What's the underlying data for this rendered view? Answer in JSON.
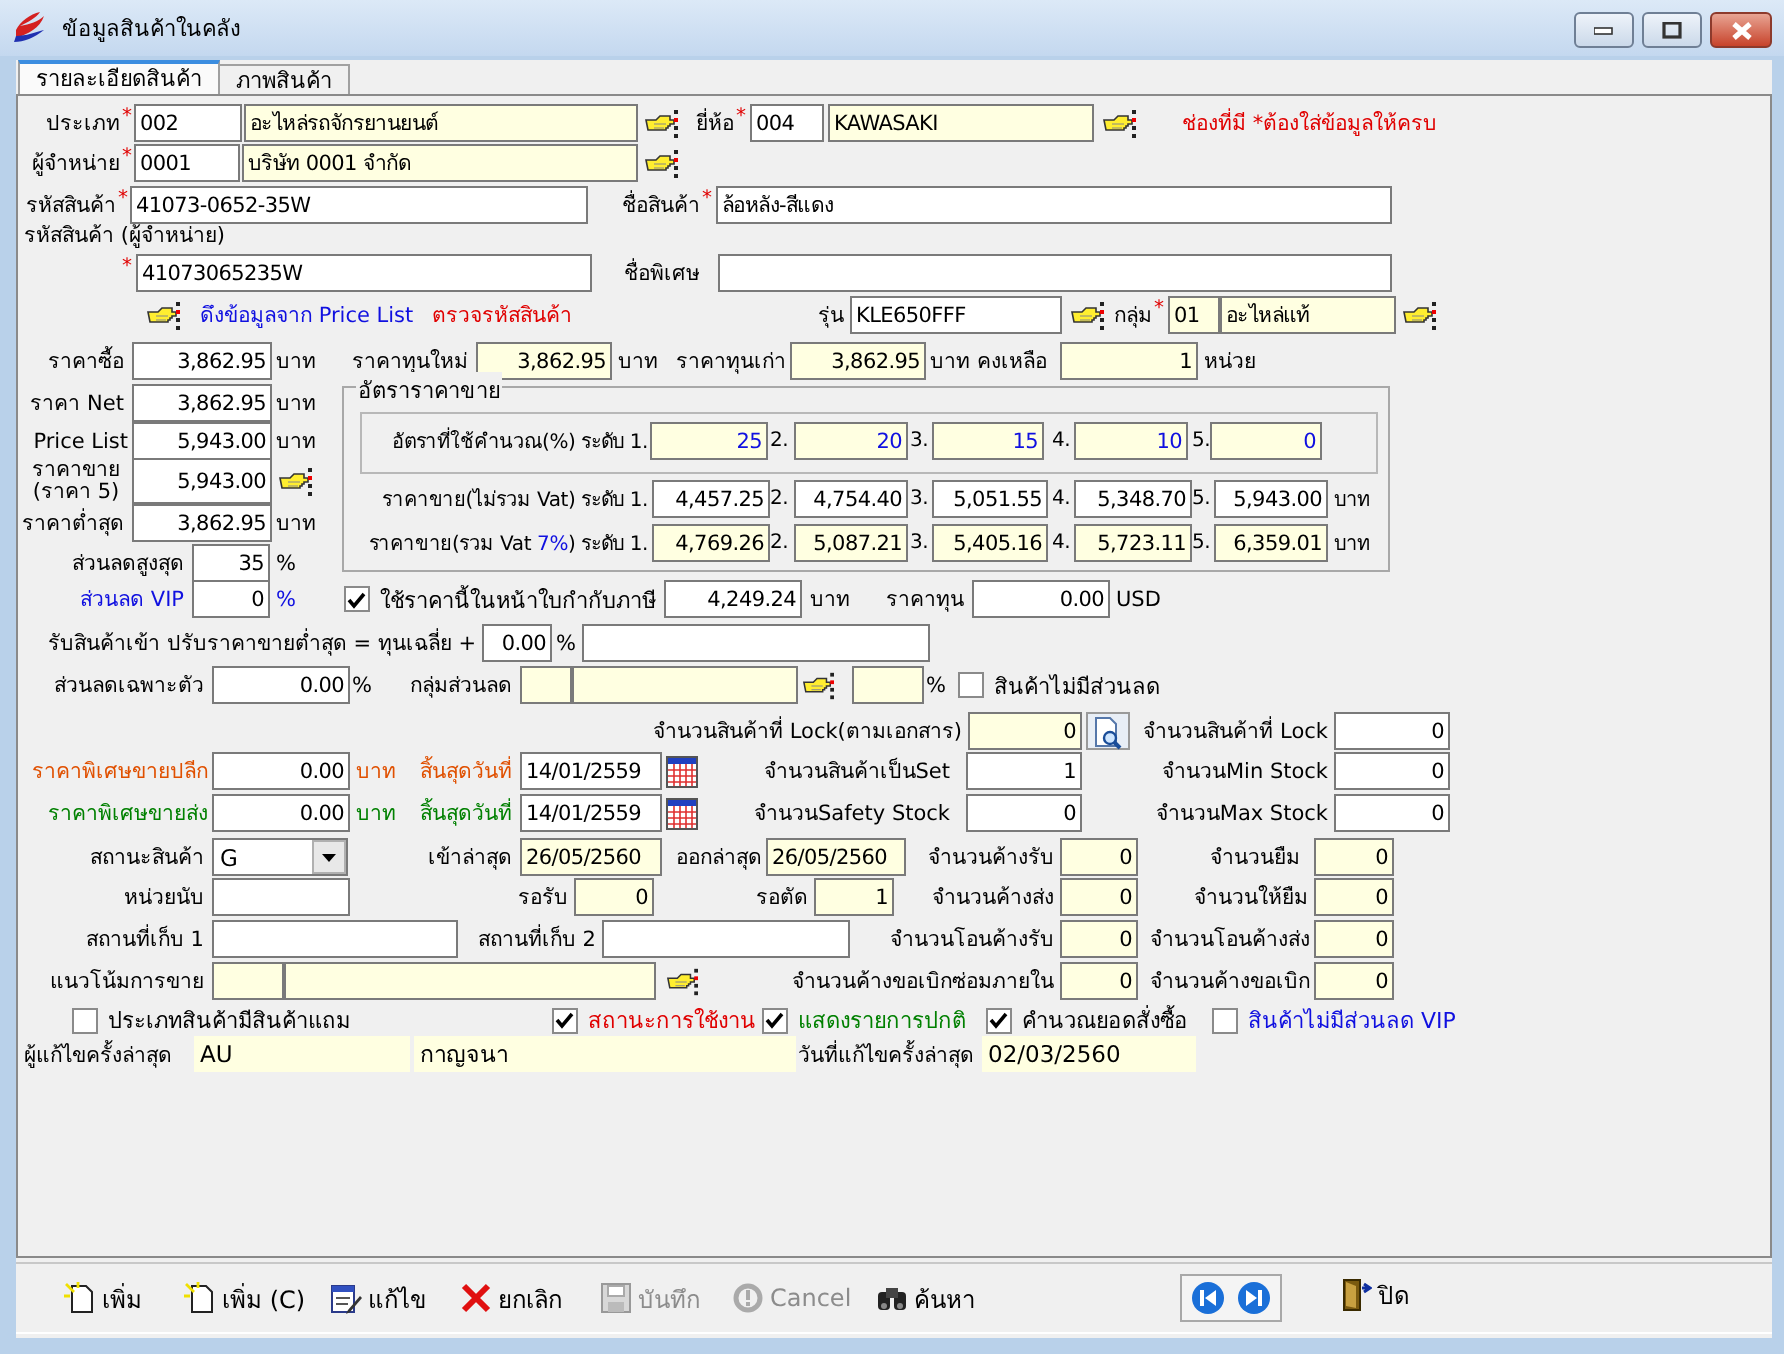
{
  "window": {
    "title": "ข้อมูลสินค้าในคลัง"
  },
  "tabs": [
    {
      "label": "รายละเอียดสินค้า",
      "selected": true
    },
    {
      "label": "ภาพสินค้า",
      "selected": false
    }
  ],
  "form": {
    "rows": [
      {
        "items": [
          {
            "kind": "label",
            "text": "ประเภท",
            "mark": "*"
          },
          {
            "kind": "field",
            "value": "002",
            "readonly": false
          },
          {
            "kind": "field",
            "value": "อะไหล่รถจักรยานยนต์",
            "readonly": true
          },
          {
            "kind": "lookup"
          },
          {
            "kind": "label",
            "text": "ยี่ห้อ",
            "mark": "*"
          },
          {
            "kind": "field",
            "value": "004",
            "readonly": false
          },
          {
            "kind": "field",
            "value": "KAWASAKI",
            "readonly": true
          },
          {
            "kind": "lookup"
          },
          {
            "kind": "note",
            "text": "ช่องที่มี *ต้องใส่ข้อมูลให้ครบ"
          }
        ]
      },
      {
        "items": [
          {
            "kind": "label",
            "text": "ผู้จำหน่าย",
            "mark": "*"
          },
          {
            "kind": "field",
            "value": "0001",
            "readonly": false
          },
          {
            "kind": "field",
            "value": "บริษัท 0001 จำกัด",
            "readonly": true
          },
          {
            "kind": "lookup"
          }
        ]
      },
      {
        "items": [
          {
            "kind": "label",
            "text": "รหัสสินค้า",
            "mark": "*"
          },
          {
            "kind": "field",
            "value": "41073-0652-35W",
            "readonly": false
          },
          {
            "kind": "label",
            "text": "ชื่อสินค้า",
            "mark": "*"
          },
          {
            "kind": "field",
            "value": "ล้อหลัง-สีแดง",
            "readonly": false
          }
        ]
      },
      {
        "items": [
          {
            "kind": "label",
            "text": "รหัสสินค้า (ผู้จำหน่าย)"
          }
        ]
      },
      {
        "items": [
          {
            "kind": "label",
            "mark": "*"
          },
          {
            "kind": "field",
            "value": "41073065235W",
            "readonly": false
          },
          {
            "kind": "label",
            "text": "ชื่อพิเศษ"
          },
          {
            "kind": "field",
            "readonly": false
          }
        ]
      },
      {
        "items": [
          {
            "kind": "lookup"
          },
          {
            "kind": "link",
            "text": "ดึงข้อมูลจาก Price List"
          },
          {
            "kind": "link",
            "text": "ตรวจรหัสสินค้า"
          },
          {
            "kind": "label",
            "text": "รุ่น"
          },
          {
            "kind": "field",
            "value": "KLE650FFF",
            "readonly": false
          },
          {
            "kind": "lookup"
          },
          {
            "kind": "label",
            "text": "กลุ่ม",
            "mark": "*"
          },
          {
            "kind": "field",
            "value": "01",
            "readonly": true
          },
          {
            "kind": "field",
            "value": "อะไหล่แท้",
            "readonly": true
          },
          {
            "kind": "lookup"
          }
        ]
      },
      {
        "items": [
          {
            "kind": "label",
            "text": "ราคาซื้อ"
          },
          {
            "kind": "field",
            "value": "3,862.95",
            "readonly": false
          },
          {
            "kind": "label",
            "text": "บาท"
          },
          {
            "kind": "label",
            "text": "ราคาทุนใหม่"
          },
          {
            "kind": "field",
            "value": "3,862.95",
            "readonly": true
          },
          {
            "kind": "label",
            "text": "บาท"
          },
          {
            "kind": "label",
            "text": "ราคาทุนเก่า"
          },
          {
            "kind": "field",
            "value": "3,862.95",
            "readonly": true
          },
          {
            "kind": "label",
            "text": "บาท คงเหลือ"
          },
          {
            "kind": "field",
            "value": "1",
            "readonly": true
          },
          {
            "kind": "label",
            "text": "หน่วย"
          }
        ]
      },
      {
        "items": [
          {
            "kind": "label",
            "text": "ราคา Net"
          },
          {
            "kind": "field",
            "value": "3,862.95",
            "readonly": false
          },
          {
            "kind": "label",
            "text": "บาท"
          }
        ]
      },
      {
        "items": [
          {
            "kind": "label",
            "text": "Price List"
          },
          {
            "kind": "field",
            "value": "5,943.00",
            "readonly": false
          },
          {
            "kind": "label",
            "text": "บาท"
          }
        ]
      },
      {
        "items": [
          {
            "kind": "label",
            "text": "ราคาขาย (ราคา 5)"
          },
          {
            "kind": "field",
            "value": "5,943.00",
            "readonly": false
          },
          {
            "kind": "lookup"
          }
        ]
      },
      {
        "items": [
          {
            "kind": "label",
            "text": "ราคาต่ำสุด"
          },
          {
            "kind": "field",
            "value": "3,862.95",
            "readonly": false
          },
          {
            "kind": "label",
            "text": "บาท"
          }
        ]
      },
      {
        "items": [
          {
            "kind": "label",
            "text": "ส่วนลดสูงสุด"
          },
          {
            "kind": "field",
            "value": "35",
            "readonly": false
          },
          {
            "kind": "label",
            "text": "%"
          }
        ]
      },
      {
        "items": [
          {
            "kind": "label",
            "text": "ส่วนลด VIP"
          },
          {
            "kind": "field",
            "value": "0",
            "readonly": false
          },
          {
            "kind": "label",
            "text": "%"
          },
          {
            "kind": "checkbox",
            "text": "ใช้ราคานี้ในหน้าใบกำกับภาษี",
            "checked": true
          },
          {
            "kind": "field",
            "value": "4,249.24",
            "readonly": false
          },
          {
            "kind": "label",
            "text": "บาท"
          },
          {
            "kind": "label",
            "text": "ราคาทุน"
          },
          {
            "kind": "field",
            "value": "0.00",
            "readonly": false
          },
          {
            "kind": "label",
            "text": "USD"
          }
        ]
      },
      {
        "items": [
          {
            "kind": "label",
            "text": "รับสินค้าเข้า ปรับราคาขายต่ำสุด = ทุนเฉลี่ย +"
          },
          {
            "kind": "field",
            "value": "0.00",
            "readonly": false
          },
          {
            "kind": "label",
            "text": "%"
          },
          {
            "kind": "field",
            "readonly": false
          }
        ]
      },
      {
        "items": [
          {
            "kind": "label",
            "text": "ส่วนลดเฉพาะตัว"
          },
          {
            "kind": "field",
            "value": "0.00",
            "readonly": false
          },
          {
            "kind": "label",
            "text": "%"
          },
          {
            "kind": "label",
            "text": "กลุ่มส่วนลด"
          },
          {
            "kind": "field",
            "readonly": true
          },
          {
            "kind": "field",
            "readonly": true
          },
          {
            "kind": "lookup"
          },
          {
            "kind": "field",
            "readonly": true
          },
          {
            "kind": "label",
            "text": "%"
          },
          {
            "kind": "checkbox",
            "text": "สินค้าไม่มีส่วนลด",
            "checked": false
          }
        ]
      },
      {
        "items": [
          {
            "kind": "label",
            "text": "จำนวนสินค้าที่ Lock(ตามเอกสาร)"
          },
          {
            "kind": "field",
            "value": "0",
            "readonly": true
          },
          {
            "kind": "search"
          },
          {
            "kind": "label",
            "text": "จำนวนสินค้าที่ Lock"
          },
          {
            "kind": "field",
            "value": "0",
            "readonly": false
          }
        ]
      },
      {
        "items": [
          {
            "kind": "label",
            "text": "ราคาพิเศษขายปลีก"
          },
          {
            "kind": "field",
            "value": "0.00",
            "readonly": false
          },
          {
            "kind": "label",
            "text": "บาท"
          },
          {
            "kind": "label",
            "text": "สิ้นสุดวันที่"
          },
          {
            "kind": "field",
            "value": "14/01/2559",
            "readonly": false
          },
          {
            "kind": "calendar"
          },
          {
            "kind": "label",
            "text": "จำนวนสินค้าเป็นSet"
          },
          {
            "kind": "field",
            "value": "1",
            "readonly": false
          },
          {
            "kind": "label",
            "text": "จำนวนMin Stock"
          },
          {
            "kind": "field",
            "value": "0",
            "readonly": false
          }
        ]
      },
      {
        "items": [
          {
            "kind": "label",
            "text": "ราคาพิเศษขายส่ง"
          },
          {
            "kind": "field",
            "value": "0.00",
            "readonly": false
          },
          {
            "kind": "label",
            "text": "บาท"
          },
          {
            "kind": "label",
            "text": "สิ้นสุดวันที่"
          },
          {
            "kind": "field",
            "value": "14/01/2559",
            "readonly": false
          },
          {
            "kind": "calendar"
          },
          {
            "kind": "label",
            "text": "จำนวนSafety Stock"
          },
          {
            "kind": "field",
            "value": "0",
            "readonly": false
          },
          {
            "kind": "label",
            "text": "จำนวนMax Stock"
          },
          {
            "kind": "field",
            "value": "0",
            "readonly": false
          }
        ]
      },
      {
        "items": [
          {
            "kind": "label",
            "text": "สถานะสินค้า"
          },
          {
            "kind": "combo",
            "value": "G"
          },
          {
            "kind": "label",
            "text": "เข้าล่าสุด"
          },
          {
            "kind": "field",
            "value": "26/05/2560",
            "readonly": true
          },
          {
            "kind": "label",
            "text": "ออกล่าสุด"
          },
          {
            "kind": "field",
            "value": "26/05/2560",
            "readonly": true
          },
          {
            "kind": "label",
            "text": "จำนวนค้างรับ"
          },
          {
            "kind": "field",
            "value": "0",
            "readonly": true
          },
          {
            "kind": "label",
            "text": "จำนวนยืม"
          },
          {
            "kind": "field",
            "value": "0",
            "readonly": true
          }
        ]
      },
      {
        "items": [
          {
            "kind": "label",
            "text": "หน่วยนับ"
          },
          {
            "kind": "field",
            "readonly": false
          },
          {
            "kind": "label",
            "text": "รอรับ"
          },
          {
            "kind": "field",
            "value": "0",
            "readonly": true
          },
          {
            "kind": "label",
            "text": "รอตัด"
          },
          {
            "kind": "field",
            "value": "1",
            "readonly": true
          },
          {
            "kind": "label",
            "text": "จำนวนค้างส่ง"
          },
          {
            "kind": "field",
            "value": "0",
            "readonly": true
          },
          {
            "kind": "label",
            "text": "จำนวนให้ยืม"
          },
          {
            "kind": "field",
            "value": "0",
            "readonly": true
          }
        ]
      },
      {
        "items": [
          {
            "kind": "label",
            "text": "สถานที่เก็บ 1"
          },
          {
            "kind": "field",
            "readonly": false
          },
          {
            "kind": "label",
            "text": "สถานที่เก็บ 2"
          },
          {
            "kind": "field",
            "readonly": false
          },
          {
            "kind": "label",
            "text": "จำนวนโอนค้างรับ"
          },
          {
            "kind": "field",
            "value": "0",
            "readonly": true
          },
          {
            "kind": "label",
            "text": "จำนวนโอนค้างส่ง"
          },
          {
            "kind": "field",
            "value": "0",
            "readonly": true
          }
        ]
      },
      {
        "items": [
          {
            "kind": "label",
            "text": "แนวโน้มการขาย"
          },
          {
            "kind": "field",
            "readonly": true
          },
          {
            "kind": "field",
            "readonly": true
          },
          {
            "kind": "lookup"
          },
          {
            "kind": "label",
            "text": "จำนวนค้างขอเบิกซ่อมภายใน"
          },
          {
            "kind": "field",
            "value": "0",
            "readonly": true
          },
          {
            "kind": "label",
            "text": "จำนวนค้างขอเบิก"
          },
          {
            "kind": "field",
            "value": "0",
            "readonly": true
          }
        ]
      },
      {
        "items": [
          {
            "kind": "checkbox",
            "text": "ประเภทสินค้ามีสินค้าแถม",
            "checked": false
          },
          {
            "kind": "checkbox",
            "text": "สถานะการใช้งาน",
            "checked": true
          },
          {
            "kind": "checkbox",
            "text": "แสดงรายการปกติ",
            "checked": true
          },
          {
            "kind": "checkbox",
            "text": "คำนวณยอดสั่งซื้อ",
            "checked": true
          },
          {
            "kind": "checkbox",
            "text": "สินค้าไม่มีส่วนลด VIP",
            "checked": false
          }
        ]
      },
      {
        "items": [
          {
            "kind": "label",
            "text": "ผู้แก้ไขครั้งล่าสุด"
          },
          {
            "kind": "display",
            "value": "AU"
          },
          {
            "kind": "display",
            "value": "กาญจนา"
          },
          {
            "kind": "label",
            "text": "วันที่แก้ไขครั้งล่าสุด"
          },
          {
            "kind": "display",
            "value": "02/03/2560"
          }
        ]
      }
    ]
  },
  "price_group": {
    "title": "อัตราราคาขาย",
    "rows": [
      {
        "items": [
          {
            "kind": "label",
            "text": "อัตราที่ใช้คำนวณ(%) ระดับ 1."
          },
          {
            "kind": "field",
            "value": "25",
            "readonly": true
          },
          {
            "kind": "label",
            "text": "2."
          },
          {
            "kind": "field",
            "value": "20",
            "readonly": true
          },
          {
            "kind": "label",
            "text": "3."
          },
          {
            "kind": "field",
            "value": "15",
            "readonly": true
          },
          {
            "kind": "label",
            "text": "4."
          },
          {
            "kind": "field",
            "value": "10",
            "readonly": true
          },
          {
            "kind": "label",
            "text": "5."
          },
          {
            "kind": "field",
            "value": "0",
            "readonly": true
          }
        ]
      },
      {
        "items": [
          {
            "kind": "label",
            "text": "ราคาขาย(ไม่รวม Vat) ระดับ 1."
          },
          {
            "kind": "field",
            "value": "4,457.25",
            "readonly": false
          },
          {
            "kind": "label",
            "text": "2."
          },
          {
            "kind": "field",
            "value": "4,754.40",
            "readonly": false
          },
          {
            "kind": "label",
            "text": "3."
          },
          {
            "kind": "field",
            "value": "5,051.55",
            "readonly": false
          },
          {
            "kind": "label",
            "text": "4."
          },
          {
            "kind": "field",
            "value": "5,348.70",
            "readonly": false
          },
          {
            "kind": "label",
            "text": "5."
          },
          {
            "kind": "field",
            "value": "5,943.00",
            "readonly": false
          },
          {
            "kind": "label",
            "text": "บาท"
          }
        ]
      },
      {
        "items": [
          {
            "kind": "label",
            "parts": [
              "ราคาขาย(รวม Vat ",
              "7%",
              ") ระดับ 1."
            ]
          },
          {
            "kind": "field",
            "value": "4,769.26",
            "readonly": true
          },
          {
            "kind": "label",
            "text": "2."
          },
          {
            "kind": "field",
            "value": "5,087.21",
            "readonly": true
          },
          {
            "kind": "label",
            "text": "3."
          },
          {
            "kind": "field",
            "value": "5,405.16",
            "readonly": true
          },
          {
            "kind": "label",
            "text": "4."
          },
          {
            "kind": "field",
            "value": "5,723.11",
            "readonly": true
          },
          {
            "kind": "label",
            "text": "5."
          },
          {
            "kind": "field",
            "value": "6,359.01",
            "readonly": true
          },
          {
            "kind": "label",
            "text": "บาท"
          }
        ]
      }
    ]
  },
  "toolbar": {
    "buttons": [
      {
        "kind": "new",
        "label": "เพิ่ม",
        "disabled": false
      },
      {
        "kind": "copy",
        "label": "เพิ่ม (C)",
        "disabled": false
      },
      {
        "kind": "edit",
        "label": "แก้ไข",
        "disabled": false
      },
      {
        "kind": "cancel",
        "label": "ยกเลิก",
        "disabled": false
      },
      {
        "kind": "save",
        "label": "บันทึก",
        "disabled": true
      },
      {
        "kind": "undo",
        "label": "Cancel",
        "disabled": true
      },
      {
        "kind": "search",
        "label": "ค้นหา",
        "disabled": false
      },
      {
        "kind": "nav"
      },
      {
        "kind": "exit",
        "label": "ปิด",
        "disabled": false
      }
    ]
  }
}
